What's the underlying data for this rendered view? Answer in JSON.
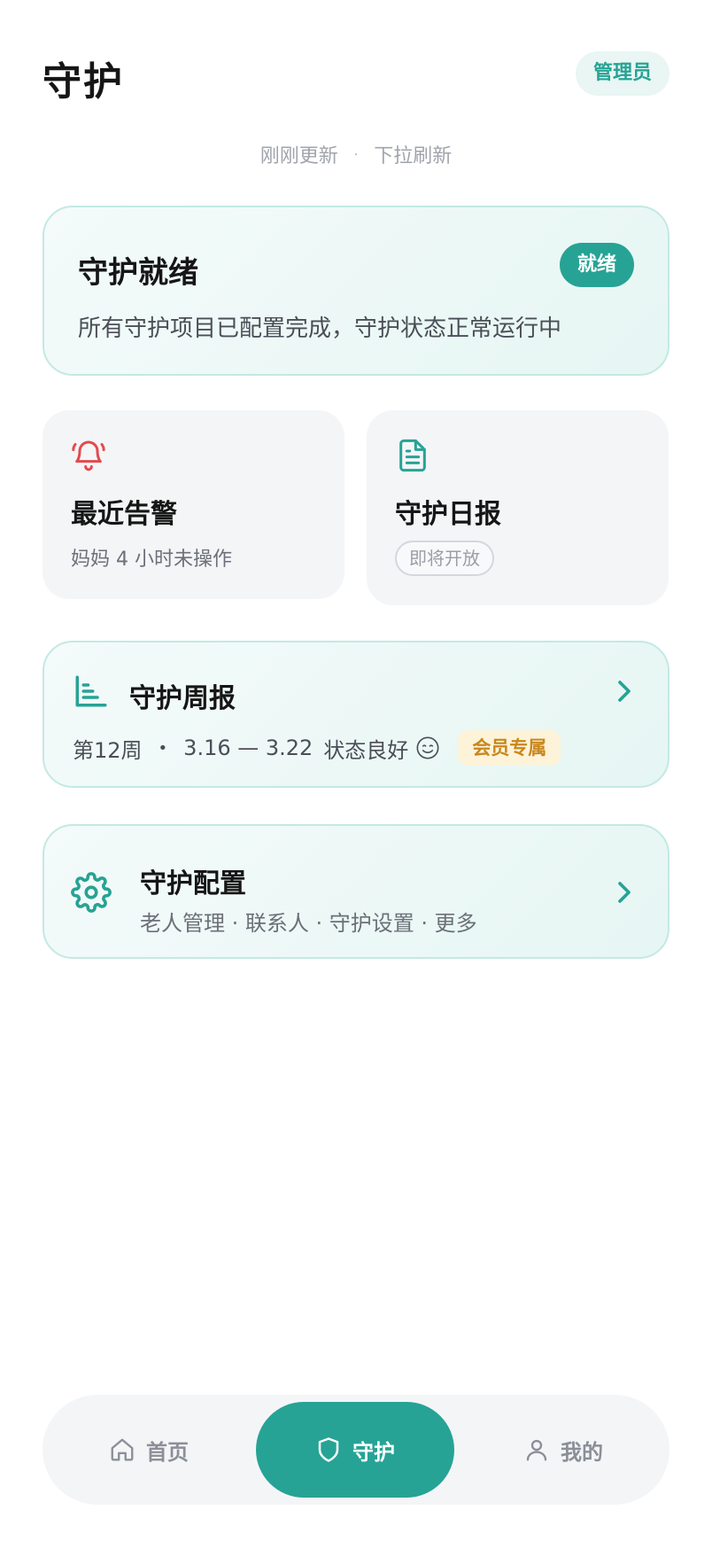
{
  "header": {
    "title": "守护",
    "role_badge": "管理员"
  },
  "refresh": {
    "updated": "刚刚更新",
    "separator": "·",
    "hint": "下拉刷新"
  },
  "status_card": {
    "title": "守护就绪",
    "badge": "就绪",
    "description": "所有守护项目已配置完成，守护状态正常运行中"
  },
  "alerts_tile": {
    "icon": "bell-icon",
    "title": "最近告警",
    "subtitle": "妈妈 4 小时未操作",
    "accent_color": "#e5484d"
  },
  "daily_tile": {
    "icon": "document-icon",
    "title": "守护日报",
    "status_pill": "即将开放"
  },
  "weekly_card": {
    "icon": "bar-chart-icon",
    "title": "守护周报",
    "week": "第12周",
    "separator": "•",
    "date_range": "3.16 — 3.22",
    "status": "状态良好",
    "status_icon": "smiley-icon",
    "member_badge": "会员专属"
  },
  "config_card": {
    "icon": "gear-icon",
    "title": "守护配置",
    "subtitle": "老人管理 · 联系人 · 守护设置 · 更多"
  },
  "tabbar": {
    "tabs": [
      {
        "label": "首页",
        "icon": "home-icon",
        "active": false
      },
      {
        "label": "守护",
        "icon": "shield-icon",
        "active": true
      },
      {
        "label": "我的",
        "icon": "user-icon",
        "active": false
      }
    ]
  },
  "colors": {
    "accent": "#26a395",
    "card_border": "#c3e9e3",
    "member_badge_bg": "#fdf3d9",
    "member_badge_text": "#c9871c"
  }
}
